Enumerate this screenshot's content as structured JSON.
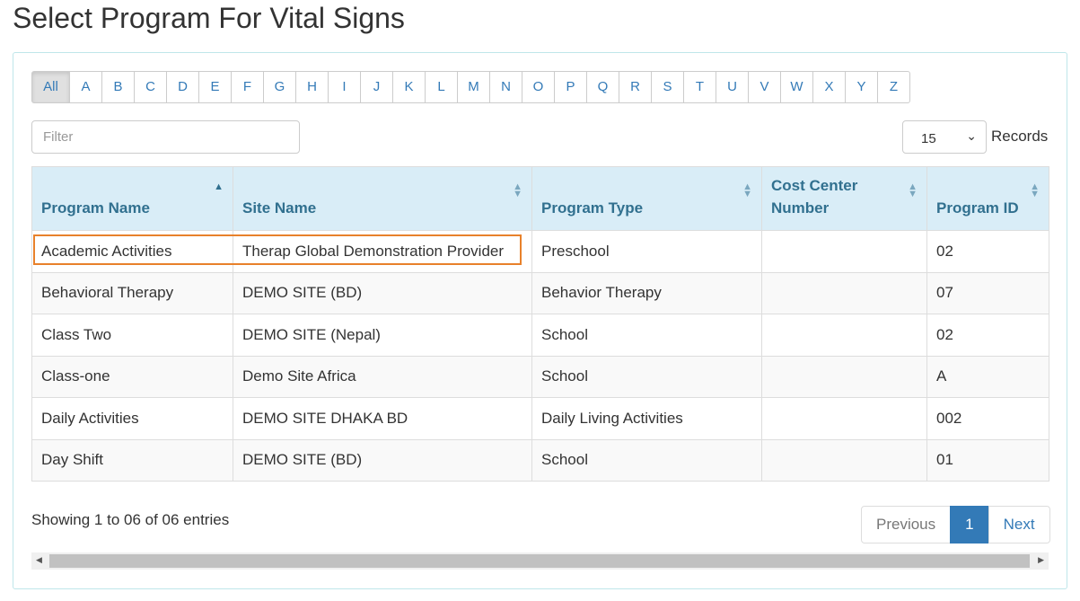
{
  "title": "Select Program For Vital Signs",
  "alphabet": [
    "All",
    "A",
    "B",
    "C",
    "D",
    "E",
    "F",
    "G",
    "H",
    "I",
    "J",
    "K",
    "L",
    "M",
    "N",
    "O",
    "P",
    "Q",
    "R",
    "S",
    "T",
    "U",
    "V",
    "W",
    "X",
    "Y",
    "Z"
  ],
  "filter_placeholder": "Filter",
  "records": {
    "value": "15",
    "label": "Records"
  },
  "columns": [
    "Program Name",
    "Site Name",
    "Program Type",
    "Cost Center Number",
    "Program ID"
  ],
  "sorted_column": "Program Name",
  "rows": [
    [
      "Academic Activities",
      "Therap Global Demonstration Provider",
      "Preschool",
      "",
      "02"
    ],
    [
      "Behavioral Therapy",
      "DEMO SITE (BD)",
      "Behavior Therapy",
      "",
      "07"
    ],
    [
      "Class Two",
      "DEMO SITE (Nepal)",
      "School",
      "",
      "02"
    ],
    [
      "Class-one",
      "Demo Site Africa",
      "School",
      "",
      "A"
    ],
    [
      "Daily Activities",
      "DEMO SITE DHAKA BD",
      "Daily Living Activities",
      "",
      "002"
    ],
    [
      "Day Shift",
      "DEMO SITE (BD)",
      "School",
      "",
      "01"
    ]
  ],
  "info": "Showing 1 to 06 of 06 entries",
  "pagination": {
    "previous": "Previous",
    "current": "1",
    "next": "Next"
  },
  "colors": {
    "header_bg": "#d9edf7",
    "accent": "#337ab7",
    "highlight": "#e8812b"
  }
}
